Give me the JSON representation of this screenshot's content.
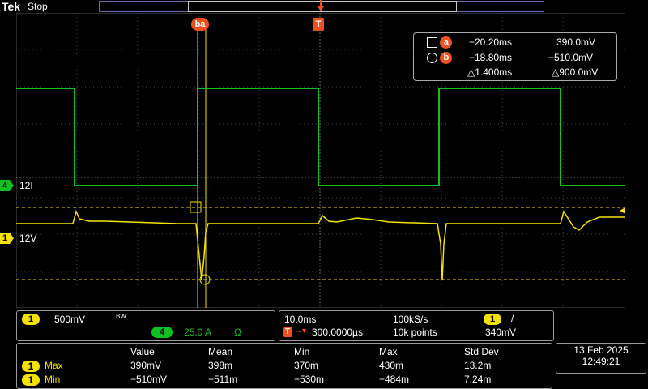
{
  "header": {
    "brand": "Tek",
    "run_state": "Stop"
  },
  "cursors": {
    "a": {
      "label": "a",
      "time": "−20.20ms",
      "value": "390.0mV"
    },
    "b": {
      "label": "b",
      "time": "−18.80ms",
      "value": "−510.0mV"
    },
    "delta_time": "△1.400ms",
    "delta_value": "△900.0mV",
    "marker_label": "ba",
    "trigger_marker": "T"
  },
  "channels": {
    "ch4": {
      "number": "4",
      "label": "12I",
      "color": "#10c020"
    },
    "ch1": {
      "number": "1",
      "label": "12V",
      "color": "#f4e200"
    }
  },
  "vertical": {
    "ch1_scale": "500mV",
    "bw_icon": "BW",
    "ch4_scale": "25.0 A",
    "ch4_termination": "Ω"
  },
  "horizontal": {
    "time_scale": "10.0ms",
    "sample_rate": "100kS/s",
    "trigger_source": "1",
    "trigger_slope": "/",
    "trigger_position": "300.0000µs",
    "record_length": "10k points",
    "trigger_level": "340mV"
  },
  "measurements": {
    "headers": [
      "Value",
      "Mean",
      "Min",
      "Max",
      "Std Dev"
    ],
    "rows": [
      {
        "ch": "1",
        "name": "Max",
        "values": [
          "390mV",
          "398m",
          "370m",
          "430m",
          "13.2m"
        ]
      },
      {
        "ch": "1",
        "name": "Min",
        "values": [
          "−510mV",
          "−511m",
          "−530m",
          "−484m",
          "7.24m"
        ]
      }
    ]
  },
  "datetime": {
    "date": "13 Feb  2025",
    "time": "12:49:21"
  }
}
